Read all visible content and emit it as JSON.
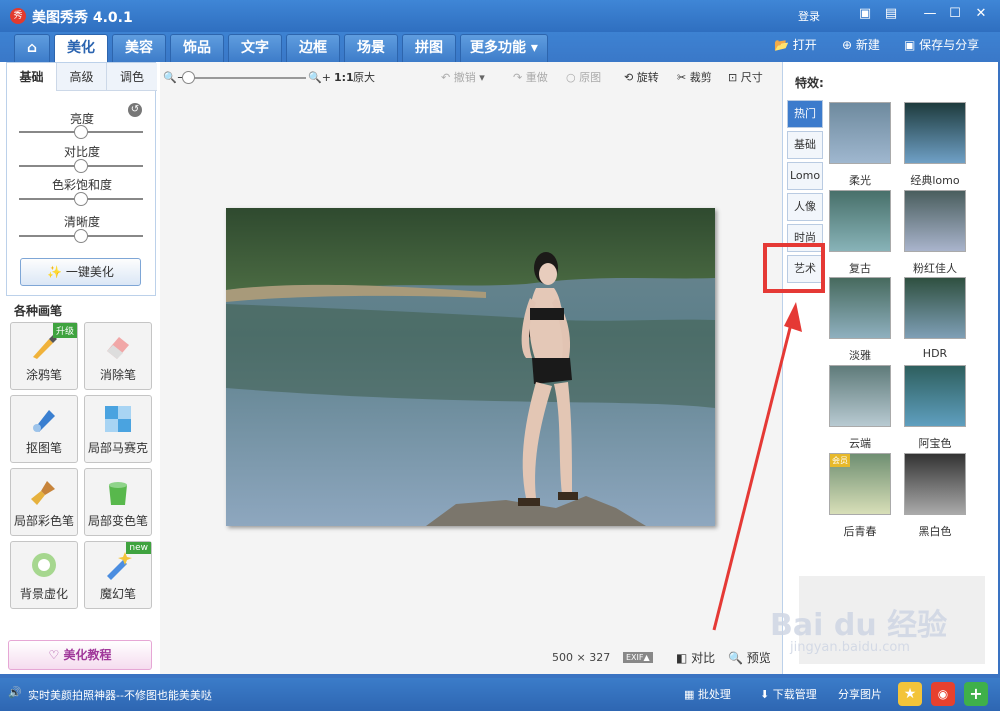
{
  "app": {
    "title": "美图秀秀 4.0.1",
    "logo_text": "秀"
  },
  "titlebar": {
    "login": "登录"
  },
  "tabs": [
    {
      "label": "美化"
    },
    {
      "label": "美容"
    },
    {
      "label": "饰品"
    },
    {
      "label": "文字"
    },
    {
      "label": "边框"
    },
    {
      "label": "场景"
    },
    {
      "label": "拼图"
    },
    {
      "label": "更多功能 ▾"
    }
  ],
  "actions": {
    "open": "打开",
    "new": "新建",
    "save": "保存与分享"
  },
  "left": {
    "subtabs": [
      "基础",
      "高级",
      "调色"
    ],
    "sliders": [
      {
        "label": "亮度",
        "value": 0.5
      },
      {
        "label": "对比度",
        "value": 0.5
      },
      {
        "label": "色彩饱和度",
        "value": 0.5
      },
      {
        "label": "清晰度",
        "value": 0.5
      }
    ],
    "one_key": "一键美化",
    "brushes_title": "各种画笔",
    "brushes": [
      {
        "label": "涂鸦笔",
        "badge": "升级"
      },
      {
        "label": "消除笔"
      },
      {
        "label": "抠图笔"
      },
      {
        "label": "局部马赛克"
      },
      {
        "label": "局部彩色笔"
      },
      {
        "label": "局部变色笔"
      },
      {
        "label": "背景虚化"
      },
      {
        "label": "魔幻笔",
        "badge": "new"
      }
    ],
    "tutorial": "美化教程"
  },
  "toolbar": {
    "zoom_ratio": "1:1",
    "original_size": "原大",
    "undo": "撤销",
    "redo": "重做",
    "restore": "原图",
    "rotate": "旋转",
    "crop": "裁剪",
    "resize": "尺寸"
  },
  "image": {
    "width": "500",
    "times": "×",
    "height": "327",
    "exif": "EXIF▲",
    "compare": "对比",
    "preview": "预览"
  },
  "effects": {
    "title": "特效:",
    "categories": [
      "热门",
      "基础",
      "Lomo",
      "人像",
      "时尚",
      "艺术"
    ],
    "items": [
      {
        "label": "柔光"
      },
      {
        "label": "经典lomo"
      },
      {
        "label": "复古"
      },
      {
        "label": "粉红佳人"
      },
      {
        "label": "淡雅"
      },
      {
        "label": "HDR"
      },
      {
        "label": "云端"
      },
      {
        "label": "阿宝色"
      },
      {
        "label": "后青春",
        "badge": "会员"
      },
      {
        "label": "黑白色"
      }
    ]
  },
  "status": {
    "tip": "实时美颜拍照神器--不修图也能美美哒",
    "batch": "批处理",
    "download": "下载管理",
    "share": "分享图片"
  },
  "watermark": {
    "brand": "Bai du 经验",
    "url": "jingyan.baidu.com"
  },
  "colors": {
    "accent": "#3a78c8",
    "highlight": "#e53935"
  }
}
